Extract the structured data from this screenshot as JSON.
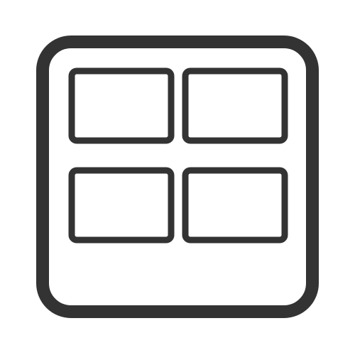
{
  "icon": {
    "name": "grid-layout-icon",
    "stroke_color": "#333333",
    "fill_color": "#ffffff",
    "background_color": "#ffffff",
    "tiles": [
      {
        "name": "grid-tile-top-left"
      },
      {
        "name": "grid-tile-top-right"
      },
      {
        "name": "grid-tile-bottom-left"
      },
      {
        "name": "grid-tile-bottom-right"
      }
    ]
  }
}
